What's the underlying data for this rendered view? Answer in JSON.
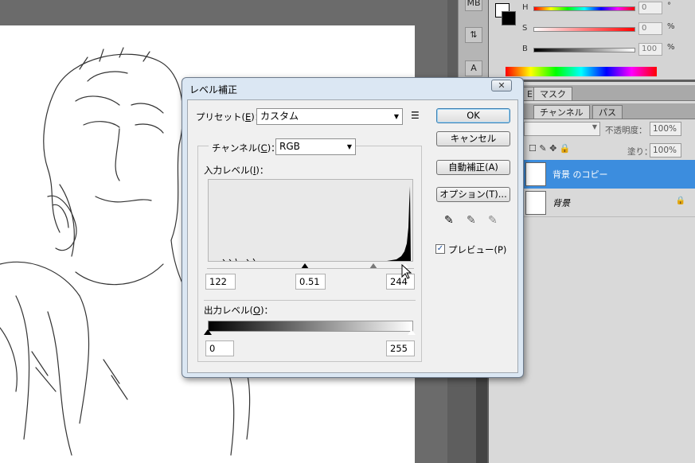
{
  "photoshop": {
    "color_panel": {
      "h_label": "H",
      "s_label": "S",
      "b_label": "B",
      "h_value": "0",
      "s_value": "0",
      "b_value": "100",
      "h_unit": "°",
      "s_unit": "%",
      "b_unit": "%"
    },
    "layers_panel": {
      "tab_top_partial": "E",
      "tab_mask": "マスク",
      "tab_channels": "チャンネル",
      "tab_paths": "パス",
      "opacity_label": "不透明度：",
      "opacity_value": "100%",
      "fill_label": "塗り：",
      "fill_value": "100%",
      "layers": [
        {
          "name": "背景 のコピー",
          "selected": true
        },
        {
          "name": "背景",
          "selected": false,
          "locked": true
        }
      ]
    },
    "toolbar": {
      "partial_label": "MB"
    }
  },
  "dialog": {
    "title": "レベル補正",
    "close_label": "✕",
    "preset_label": "プリセット(",
    "preset_key": "E",
    "preset_suffix": ")：",
    "preset_value": "カスタム",
    "channel_label": "チャンネル(",
    "channel_key": "C",
    "channel_suffix": ")：",
    "channel_value": "RGB",
    "input_levels_label": "入力レベル(",
    "input_levels_key": "I",
    "input_levels_suffix": ")：",
    "input_black": "122",
    "input_gamma": "0.51",
    "input_white": "244",
    "output_levels_label": "出力レベル(",
    "output_levels_key": "O",
    "output_levels_suffix": ")：",
    "output_black": "0",
    "output_white": "255",
    "buttons": {
      "ok": "OK",
      "cancel": "キャンセル",
      "auto": "自動補正(A)",
      "options": "オプション(T)..."
    },
    "preview_label": "プレビュー(P)",
    "preview_checked": true
  },
  "colors": {
    "selection_blue": "#3c8dde",
    "dialog_frame": "#dbe7f3"
  }
}
